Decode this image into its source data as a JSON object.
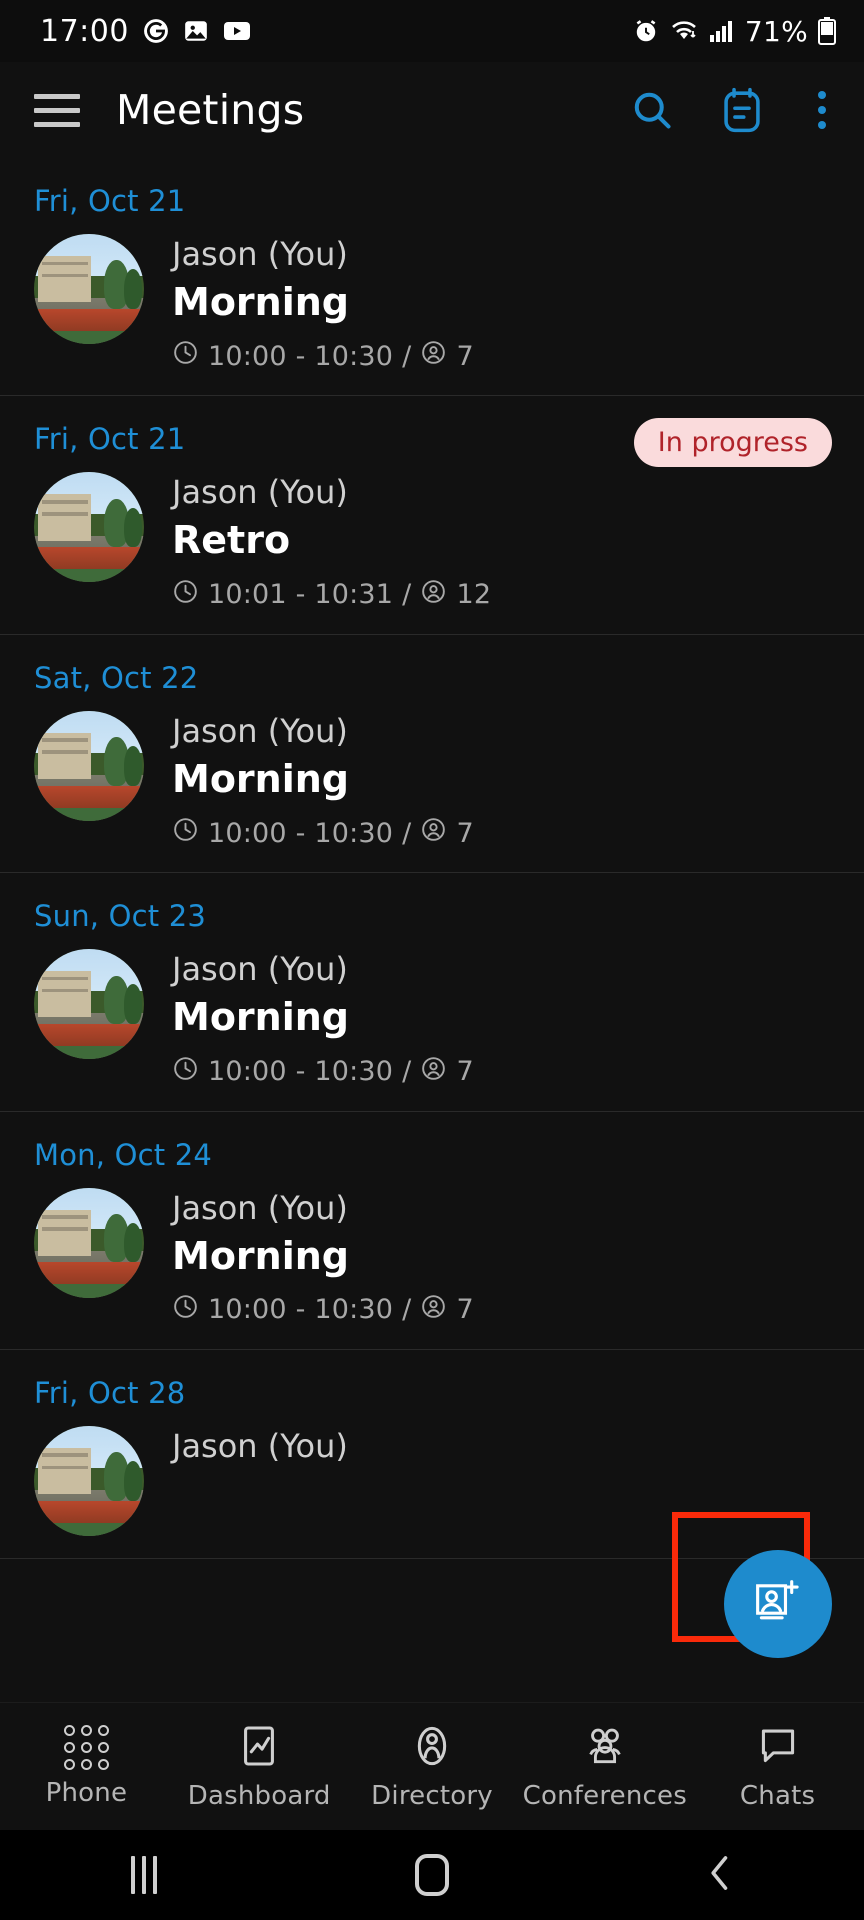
{
  "status_bar": {
    "time": "17:00",
    "battery_percent": "71%",
    "left_icons": [
      "g-circle-icon",
      "gallery-icon",
      "youtube-icon"
    ],
    "right_icons": [
      "alarm-icon",
      "wifi-icon",
      "signal-icon",
      "battery-icon"
    ]
  },
  "app_bar": {
    "menu_icon": "hamburger-menu-icon",
    "title": "Meetings",
    "actions": [
      {
        "name": "search-icon"
      },
      {
        "name": "agenda-icon"
      },
      {
        "name": "overflow-menu-icon"
      }
    ]
  },
  "colors": {
    "background": "#111111",
    "accent_blue": "#1e8bcd",
    "date_blue": "#1f8fd6",
    "badge_bg": "#fadbdc",
    "badge_text": "#b0232a",
    "highlight_red": "#fa2a0a"
  },
  "meetings": [
    {
      "date": "Fri, Oct 21",
      "owner": "Jason (You)",
      "title": "Morning",
      "time": "10:00 - 10:30",
      "separator": "/",
      "participants": "7",
      "badge": ""
    },
    {
      "date": "Fri, Oct 21",
      "owner": "Jason (You)",
      "title": "Retro",
      "time": "10:01 - 10:31",
      "separator": "/",
      "participants": "12",
      "badge": "In progress"
    },
    {
      "date": "Sat, Oct 22",
      "owner": "Jason (You)",
      "title": "Morning",
      "time": "10:00 - 10:30",
      "separator": "/",
      "participants": "7",
      "badge": ""
    },
    {
      "date": "Sun, Oct 23",
      "owner": "Jason (You)",
      "title": "Morning",
      "time": "10:00 - 10:30",
      "separator": "/",
      "participants": "7",
      "badge": ""
    },
    {
      "date": "Mon, Oct 24",
      "owner": "Jason (You)",
      "title": "Morning",
      "time": "10:00 - 10:30",
      "separator": "/",
      "participants": "7",
      "badge": ""
    },
    {
      "date": "Fri, Oct 28",
      "owner": "Jason (You)",
      "title": "",
      "time": "",
      "separator": "",
      "participants": "",
      "badge": ""
    }
  ],
  "fab": {
    "icon": "add-meeting-icon",
    "highlighted": true
  },
  "bottom_nav": [
    {
      "label": "Phone",
      "icon": "dialpad-icon"
    },
    {
      "label": "Dashboard",
      "icon": "chart-icon"
    },
    {
      "label": "Directory",
      "icon": "person-oval-icon"
    },
    {
      "label": "Conferences",
      "icon": "group-icon"
    },
    {
      "label": "Chats",
      "icon": "speech-bubble-icon"
    }
  ],
  "android_nav": [
    {
      "name": "recents-button"
    },
    {
      "name": "home-button"
    },
    {
      "name": "back-button"
    }
  ]
}
